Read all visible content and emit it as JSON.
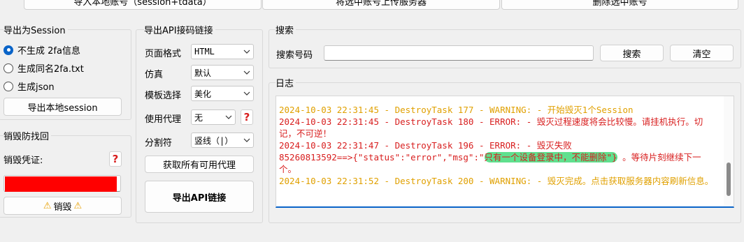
{
  "top_buttons": [
    {
      "label": "导入本地账号（session+tdata）"
    },
    {
      "label": "将选中账号上传服务器"
    },
    {
      "label": "删除选中账号"
    }
  ],
  "export_session": {
    "title": "导出为Session",
    "options": [
      "不生成 2fa信息",
      "生成同名2fa.txt",
      "生成json"
    ],
    "selected_index": 0,
    "button": "导出本地session"
  },
  "destroy": {
    "title": "销毁防找回",
    "credential_label": "销毁凭证:",
    "help_icon": "?",
    "input_value": "",
    "button": "销毁",
    "warning_icon": "⚠"
  },
  "api_export": {
    "title": "导出API接码链接",
    "fields": [
      {
        "label": "页面格式",
        "value": "HTML"
      },
      {
        "label": "仿真",
        "value": "默认"
      },
      {
        "label": "模板选择",
        "value": "美化"
      },
      {
        "label": "使用代理",
        "value": "无"
      },
      {
        "label": "分割符",
        "value": "竖线（|）"
      }
    ],
    "proxy_help": "?",
    "fetch_proxy_button": "获取所有可用代理",
    "export_button": "导出API链接"
  },
  "search": {
    "title": "搜索",
    "label": "搜索号码",
    "value": "",
    "search_button": "搜索",
    "clear_button": "清空"
  },
  "log": {
    "title": "日志",
    "lines": [
      {
        "level": "warn",
        "text": "2024-10-03 22:31:45 - DestroyTask 177 - WARNING: - 开始毁灭1个Session"
      },
      {
        "level": "err",
        "text": "2024-10-03 22:31:45 - DestroyTask 180 - ERROR: - 毁灭过程速度将会比较慢。请挂机执行。切记，不可逆！"
      },
      {
        "level": "err",
        "text": "2024-10-03 22:31:47 - DestroyTask 196 - ERROR: - 毁灭失败"
      },
      {
        "level": "err",
        "text_before": "85260813592==>{\"status\":\"error\",\"msg\":\"",
        "text_highlight": "只有一个设备登录中，不能删除\"}",
        "text_after": " 。等待片刻继续下一个。"
      },
      {
        "level": "warn",
        "text": "2024-10-03 22:31:52 - DestroyTask 200 - WARNING: - 毁灭完成。点击获取服务器内容刷新信息。"
      }
    ]
  },
  "colors": {
    "warning_text": "#e0a000",
    "error_text": "#d81e1e",
    "accent": "#0a64c8",
    "highlight": "#5fe08e",
    "redaction": "#ff0000"
  }
}
